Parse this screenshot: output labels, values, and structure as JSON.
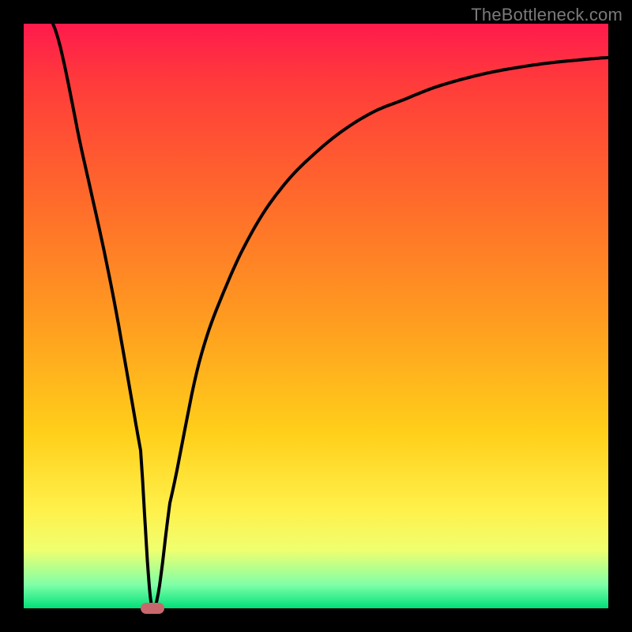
{
  "attribution": "TheBottleneck.com",
  "colors": {
    "gradient_top": "#ff1a4d",
    "gradient_mid1": "#ff6a2b",
    "gradient_mid2": "#ffcf1a",
    "gradient_bottom": "#00e07a",
    "curve": "#000000",
    "marker": "#c9686c",
    "frame": "#000000"
  },
  "chart_data": {
    "type": "line",
    "title": "",
    "xlabel": "",
    "ylabel": "",
    "xlim": [
      0,
      100
    ],
    "ylim": [
      0,
      100
    ],
    "grid": false,
    "series": [
      {
        "name": "bottleneck-curve",
        "x": [
          5,
          10,
          15,
          20,
          22,
          25,
          30,
          35,
          40,
          45,
          50,
          55,
          60,
          65,
          70,
          75,
          80,
          85,
          90,
          95,
          100
        ],
        "y": [
          100,
          78,
          55,
          27,
          0,
          18,
          42,
          56,
          66,
          73,
          78,
          82,
          85,
          87,
          89,
          90.5,
          91.7,
          92.6,
          93.3,
          93.8,
          94.2
        ]
      }
    ],
    "marker": {
      "x": 22,
      "y": 0
    }
  }
}
